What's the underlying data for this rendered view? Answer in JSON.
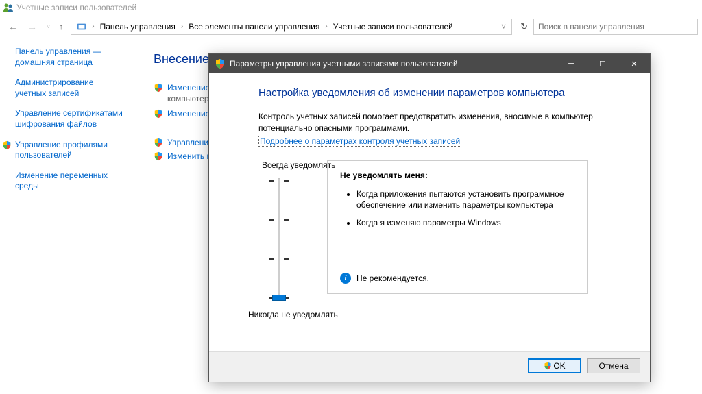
{
  "window": {
    "title": "Учетные записи пользователей"
  },
  "breadcrumb": {
    "items": [
      "Панель управления",
      "Все элементы панели управления",
      "Учетные записи пользователей"
    ]
  },
  "search": {
    "placeholder": "Поиск в панели управления"
  },
  "sidebar": {
    "items": [
      {
        "label": "Панель управления — домашняя страница",
        "shield": false
      },
      {
        "label": "Администрирование учетных записей",
        "shield": false
      },
      {
        "label": "Управление сертификатами шифрования файлов",
        "shield": false
      },
      {
        "label": "Управление профилями пользователей",
        "shield": true
      },
      {
        "label": "Изменение переменных среды",
        "shield": false
      }
    ]
  },
  "main": {
    "title": "Внесение изменений в учетную запись пользователя",
    "tasks": [
      {
        "label": "Изменение",
        "sub": "компьютера",
        "shield": true
      },
      {
        "label": "Изменение",
        "shield": true
      },
      {
        "label": "Управление",
        "shield": true
      },
      {
        "label": "Изменить п",
        "shield": true
      }
    ]
  },
  "dialog": {
    "title": "Параметры управления учетными записями пользователей",
    "heading": "Настройка уведомления об изменении параметров компьютера",
    "desc": "Контроль учетных записей помогает предотвратить изменения, вносимые в компьютер потенциально опасными программами.",
    "link": "Подробнее о параметрах контроля учетных записей",
    "slider": {
      "top_label": "Всегда уведомлять",
      "bot_label": "Никогда не уведомлять",
      "level": 0,
      "max_level": 3
    },
    "info": {
      "heading": "Не уведомлять меня:",
      "items": [
        "Когда приложения пытаются установить программное обеспечение или изменить параметры компьютера",
        "Когда я изменяю параметры Windows"
      ],
      "recommendation": "Не рекомендуется."
    },
    "buttons": {
      "ok": "OK",
      "cancel": "Отмена"
    }
  }
}
